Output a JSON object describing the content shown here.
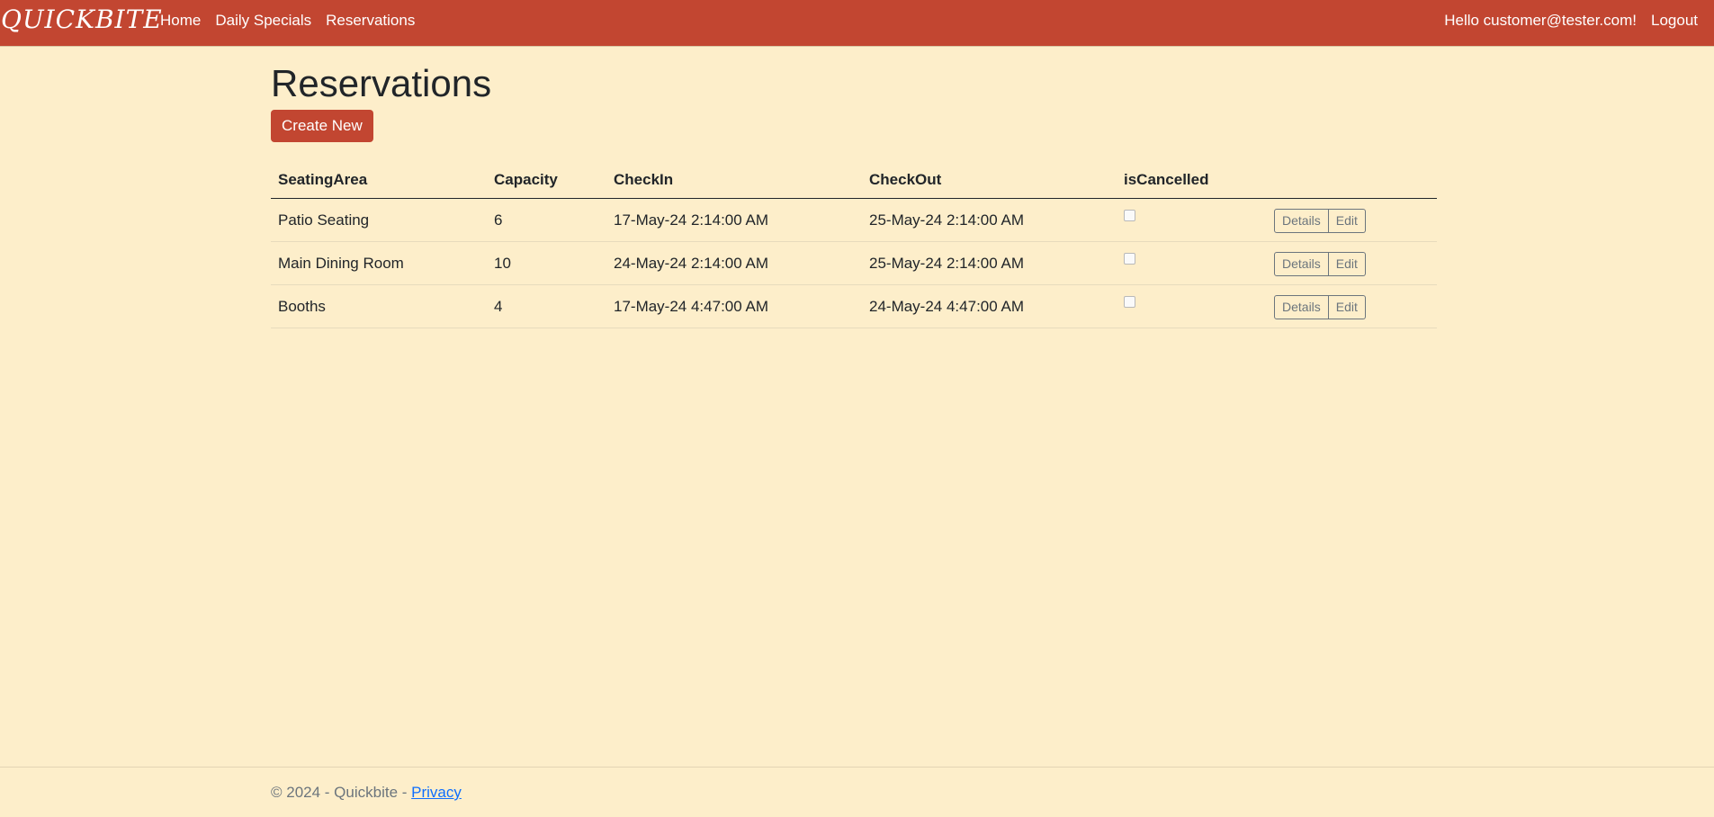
{
  "nav": {
    "brand": "QUICKBITE",
    "links": [
      "Home",
      "Daily Specials",
      "Reservations"
    ],
    "hello": "Hello customer@tester.com!",
    "logout": "Logout"
  },
  "page": {
    "title": "Reservations",
    "create_label": "Create New"
  },
  "table": {
    "headers": [
      "SeatingArea",
      "Capacity",
      "CheckIn",
      "CheckOut",
      "isCancelled",
      ""
    ],
    "rows": [
      {
        "seating": "Patio Seating",
        "capacity": "6",
        "checkin": "17-May-24 2:14:00 AM",
        "checkout": "25-May-24 2:14:00 AM",
        "cancelled": false,
        "details": "Details",
        "edit": "Edit"
      },
      {
        "seating": "Main Dining Room",
        "capacity": "10",
        "checkin": "24-May-24 2:14:00 AM",
        "checkout": "25-May-24 2:14:00 AM",
        "cancelled": false,
        "details": "Details",
        "edit": "Edit"
      },
      {
        "seating": "Booths",
        "capacity": "4",
        "checkin": "17-May-24 4:47:00 AM",
        "checkout": "24-May-24 4:47:00 AM",
        "cancelled": false,
        "details": "Details",
        "edit": "Edit"
      }
    ]
  },
  "footer": {
    "text": "© 2024 - Quickbite - ",
    "privacy": "Privacy"
  },
  "colors": {
    "accent": "#c24631",
    "background": "#fdeeca"
  }
}
